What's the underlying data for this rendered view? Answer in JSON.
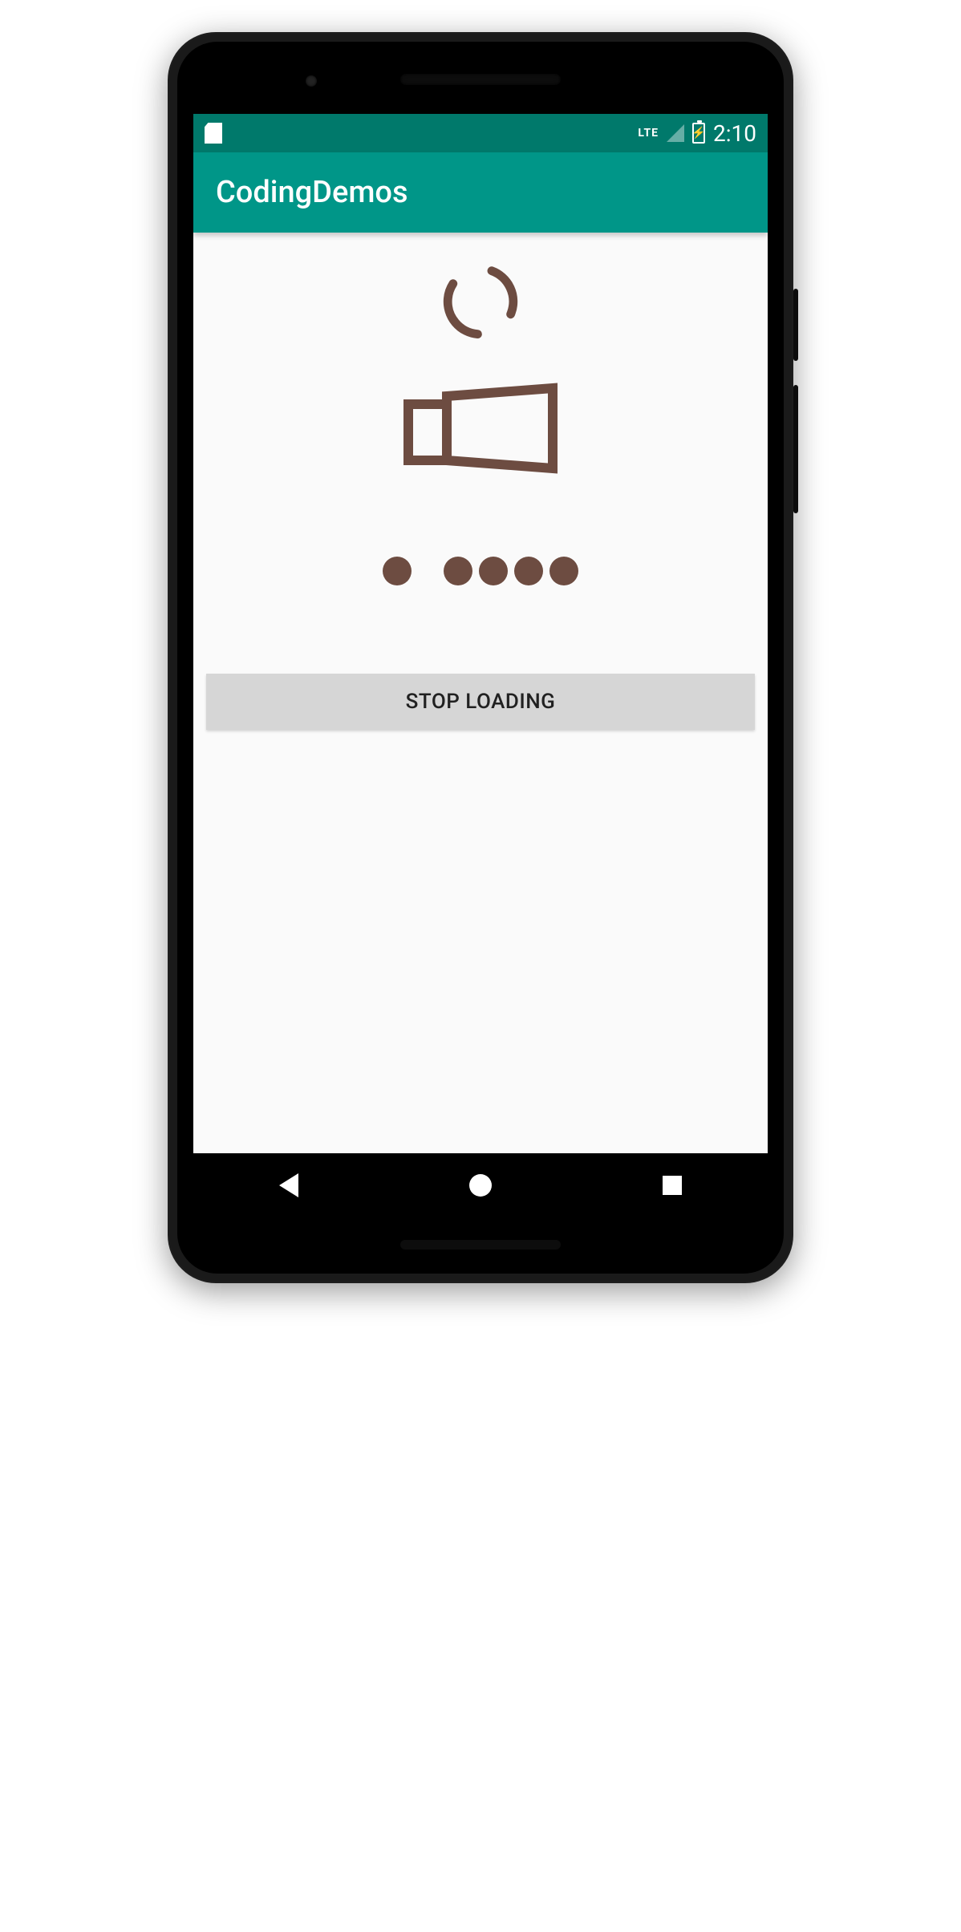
{
  "status": {
    "lte": "LTE",
    "time": "2:10"
  },
  "appbar": {
    "title": "CodingDemos"
  },
  "button": {
    "stop_label": "STOP LOADING"
  },
  "colors": {
    "primary": "#009688",
    "primary_dark": "#00796b",
    "accent": "#6d4c41"
  }
}
